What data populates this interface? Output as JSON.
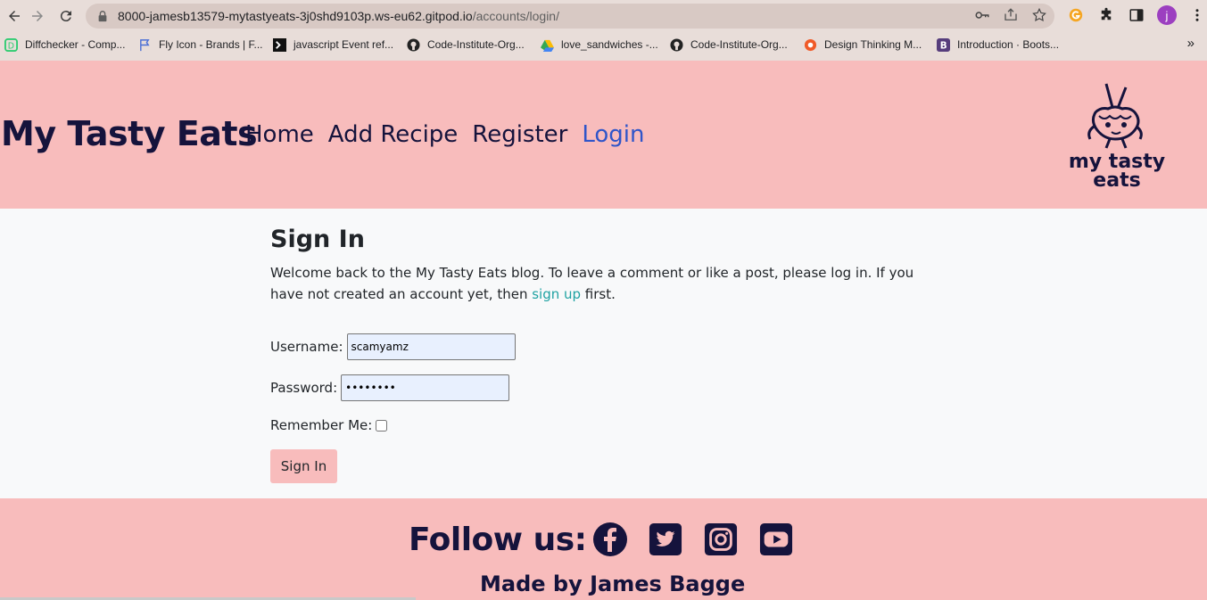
{
  "browser": {
    "url_host": "8000-jamesb13579-mytastyeats-3j0shd9103p.ws-eu62.gitpod.io",
    "url_path": "/accounts/login/",
    "avatar_letter": "j",
    "bookmarks": [
      {
        "label": "Diffchecker - Comp...",
        "icon": "diffchecker-icon"
      },
      {
        "label": "Fly Icon - Brands | F...",
        "icon": "flag-icon"
      },
      {
        "label": "javascript Event ref...",
        "icon": "w3-icon"
      },
      {
        "label": "Code-Institute-Org...",
        "icon": "github-icon"
      },
      {
        "label": "love_sandwiches -...",
        "icon": "drive-icon"
      },
      {
        "label": "Code-Institute-Org...",
        "icon": "github-icon"
      },
      {
        "label": "Design Thinking M...",
        "icon": "circle-icon"
      },
      {
        "label": "Introduction · Boots...",
        "icon": "bootstrap-icon"
      }
    ],
    "more_bookmarks": "»"
  },
  "header": {
    "brand": "My Tasty Eats",
    "nav": [
      {
        "label": "Home"
      },
      {
        "label": "Add Recipe"
      },
      {
        "label": "Register"
      },
      {
        "label": "Login",
        "active": true
      }
    ],
    "logo_line1": "my tasty",
    "logo_line2": "eats"
  },
  "main": {
    "title": "Sign In",
    "intro_text": "Welcome back to the My Tasty Eats blog. To leave a comment or like a post, please log in. If you have not created an account yet, then ",
    "intro_link": "sign up",
    "intro_end": " first.",
    "username_label": "Username:",
    "username_value": "scamyamz",
    "password_label": "Password:",
    "password_value": "••••••••",
    "remember_label": "Remember Me:",
    "submit_label": "Sign In"
  },
  "footer": {
    "follow": "Follow us:",
    "social": [
      "facebook-icon",
      "twitter-icon",
      "instagram-icon",
      "youtube-icon"
    ],
    "made_by": "Made by James Bagge"
  },
  "colors": {
    "brand_pink": "#f8bcbc",
    "navy": "#15133c",
    "active_link": "#2f55c9",
    "teal_link": "#1fa2a2"
  }
}
